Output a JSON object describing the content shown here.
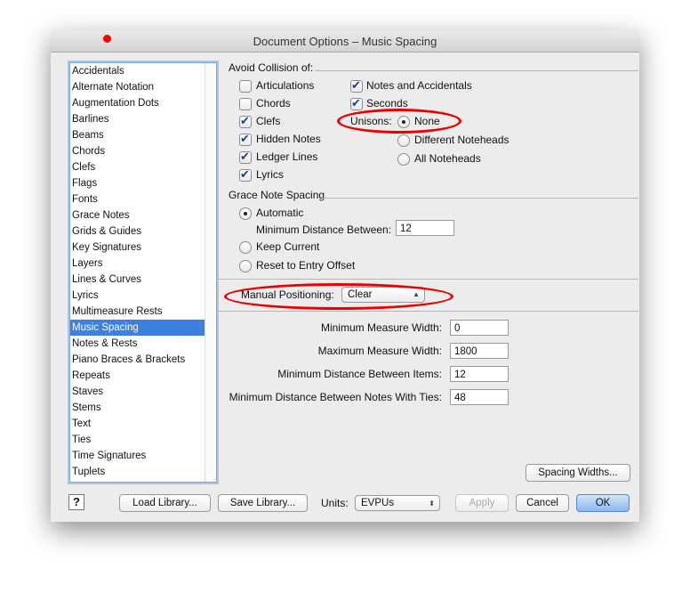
{
  "window": {
    "title": "Document Options – Music Spacing"
  },
  "sidebar": {
    "items": [
      "Accidentals",
      "Alternate Notation",
      "Augmentation Dots",
      "Barlines",
      "Beams",
      "Chords",
      "Clefs",
      "Flags",
      "Fonts",
      "Grace Notes",
      "Grids & Guides",
      "Key Signatures",
      "Layers",
      "Lines & Curves",
      "Lyrics",
      "Multimeasure Rests",
      "Music Spacing",
      "Notes & Rests",
      "Piano Braces & Brackets",
      "Repeats",
      "Staves",
      "Stems",
      "Text",
      "Ties",
      "Time Signatures",
      "Tuplets"
    ],
    "selected": "Music Spacing"
  },
  "collision": {
    "heading": "Avoid Collision of:",
    "left": [
      {
        "label": "Articulations",
        "checked": false
      },
      {
        "label": "Chords",
        "checked": false
      },
      {
        "label": "Clefs",
        "checked": true
      },
      {
        "label": "Hidden Notes",
        "checked": true
      },
      {
        "label": "Ledger Lines",
        "checked": true
      },
      {
        "label": "Lyrics",
        "checked": true
      }
    ],
    "right": [
      {
        "label": "Notes and Accidentals",
        "checked": true
      },
      {
        "label": "Seconds",
        "checked": true
      }
    ],
    "unisons_label": "Unisons:",
    "unisons": [
      {
        "label": "None",
        "selected": true
      },
      {
        "label": "Different Noteheads",
        "selected": false
      },
      {
        "label": "All Noteheads",
        "selected": false
      }
    ]
  },
  "grace": {
    "heading": "Grace Note Spacing",
    "automatic": "Automatic",
    "min_distance_label": "Minimum Distance Between:",
    "min_distance": "12",
    "keep_current": "Keep Current",
    "reset": "Reset to Entry Offset",
    "selected": "Automatic"
  },
  "manual": {
    "label": "Manual Positioning:",
    "value": "Clear"
  },
  "measures": {
    "fields": [
      {
        "label": "Minimum Measure Width:",
        "value": "0"
      },
      {
        "label": "Maximum Measure Width:",
        "value": "1800"
      },
      {
        "label": "Minimum Distance Between Items:",
        "value": "12"
      },
      {
        "label": "Minimum Distance Between Notes With Ties:",
        "value": "48"
      }
    ]
  },
  "buttons": {
    "spacing_widths": "Spacing Widths...",
    "help": "?",
    "load": "Load Library...",
    "save": "Save Library...",
    "units_label": "Units:",
    "units": "EVPUs",
    "apply": "Apply",
    "cancel": "Cancel",
    "ok": "OK"
  },
  "annotation_color": "#e00000"
}
